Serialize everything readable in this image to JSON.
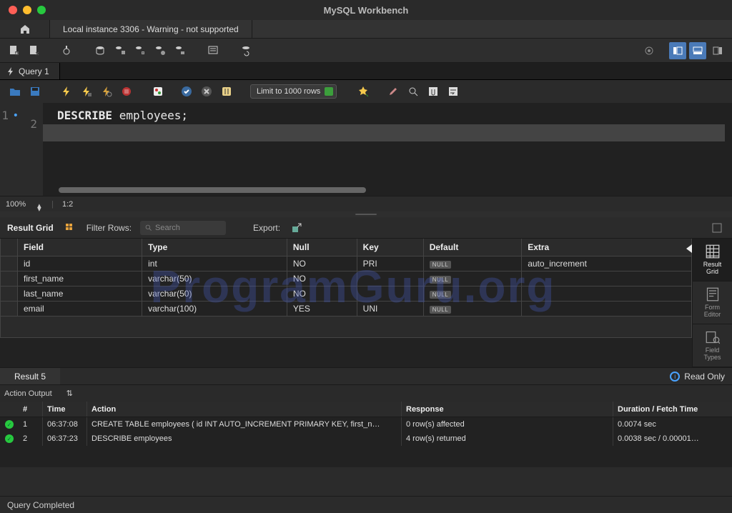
{
  "window": {
    "title": "MySQL Workbench"
  },
  "connection_tab": "Local instance 3306 - Warning - not supported",
  "query_tab": "Query 1",
  "limit_select": "Limit to 1000 rows",
  "editor": {
    "line1": {
      "keyword": "DESCRIBE",
      "ident": "employees",
      "punct": ";"
    },
    "zoom": "100%",
    "cursor": "1:2"
  },
  "result_toolbar": {
    "label": "Result Grid",
    "filter_label": "Filter Rows:",
    "search_placeholder": "Search",
    "export_label": "Export:"
  },
  "grid": {
    "columns": [
      "Field",
      "Type",
      "Null",
      "Key",
      "Default",
      "Extra"
    ],
    "rows": [
      {
        "Field": "id",
        "Type": "int",
        "Null": "NO",
        "Key": "PRI",
        "Default": null,
        "Extra": "auto_increment"
      },
      {
        "Field": "first_name",
        "Type": "varchar(50)",
        "Null": "NO",
        "Key": "",
        "Default": null,
        "Extra": ""
      },
      {
        "Field": "last_name",
        "Type": "varchar(50)",
        "Null": "NO",
        "Key": "",
        "Default": null,
        "Extra": ""
      },
      {
        "Field": "email",
        "Type": "varchar(100)",
        "Null": "YES",
        "Key": "UNI",
        "Default": null,
        "Extra": ""
      }
    ]
  },
  "side_tabs": [
    "Result\nGrid",
    "Form\nEditor",
    "Field\nTypes"
  ],
  "result_tab": "Result 5",
  "readonly": "Read Only",
  "action_output_label": "Action Output",
  "output": {
    "columns": [
      "",
      "#",
      "Time",
      "Action",
      "Response",
      "Duration / Fetch Time"
    ],
    "rows": [
      {
        "idx": "1",
        "time": "06:37:08",
        "action": "CREATE TABLE employees (     id INT AUTO_INCREMENT PRIMARY KEY,     first_n…",
        "response": "0 row(s) affected",
        "duration": "0.0074 sec"
      },
      {
        "idx": "2",
        "time": "06:37:23",
        "action": "DESCRIBE employees",
        "response": "4 row(s) returned",
        "duration": "0.0038 sec / 0.00001…"
      }
    ]
  },
  "watermark": "ProgramGuru.org",
  "statusbar": "Query Completed",
  "null_label": "NULL"
}
